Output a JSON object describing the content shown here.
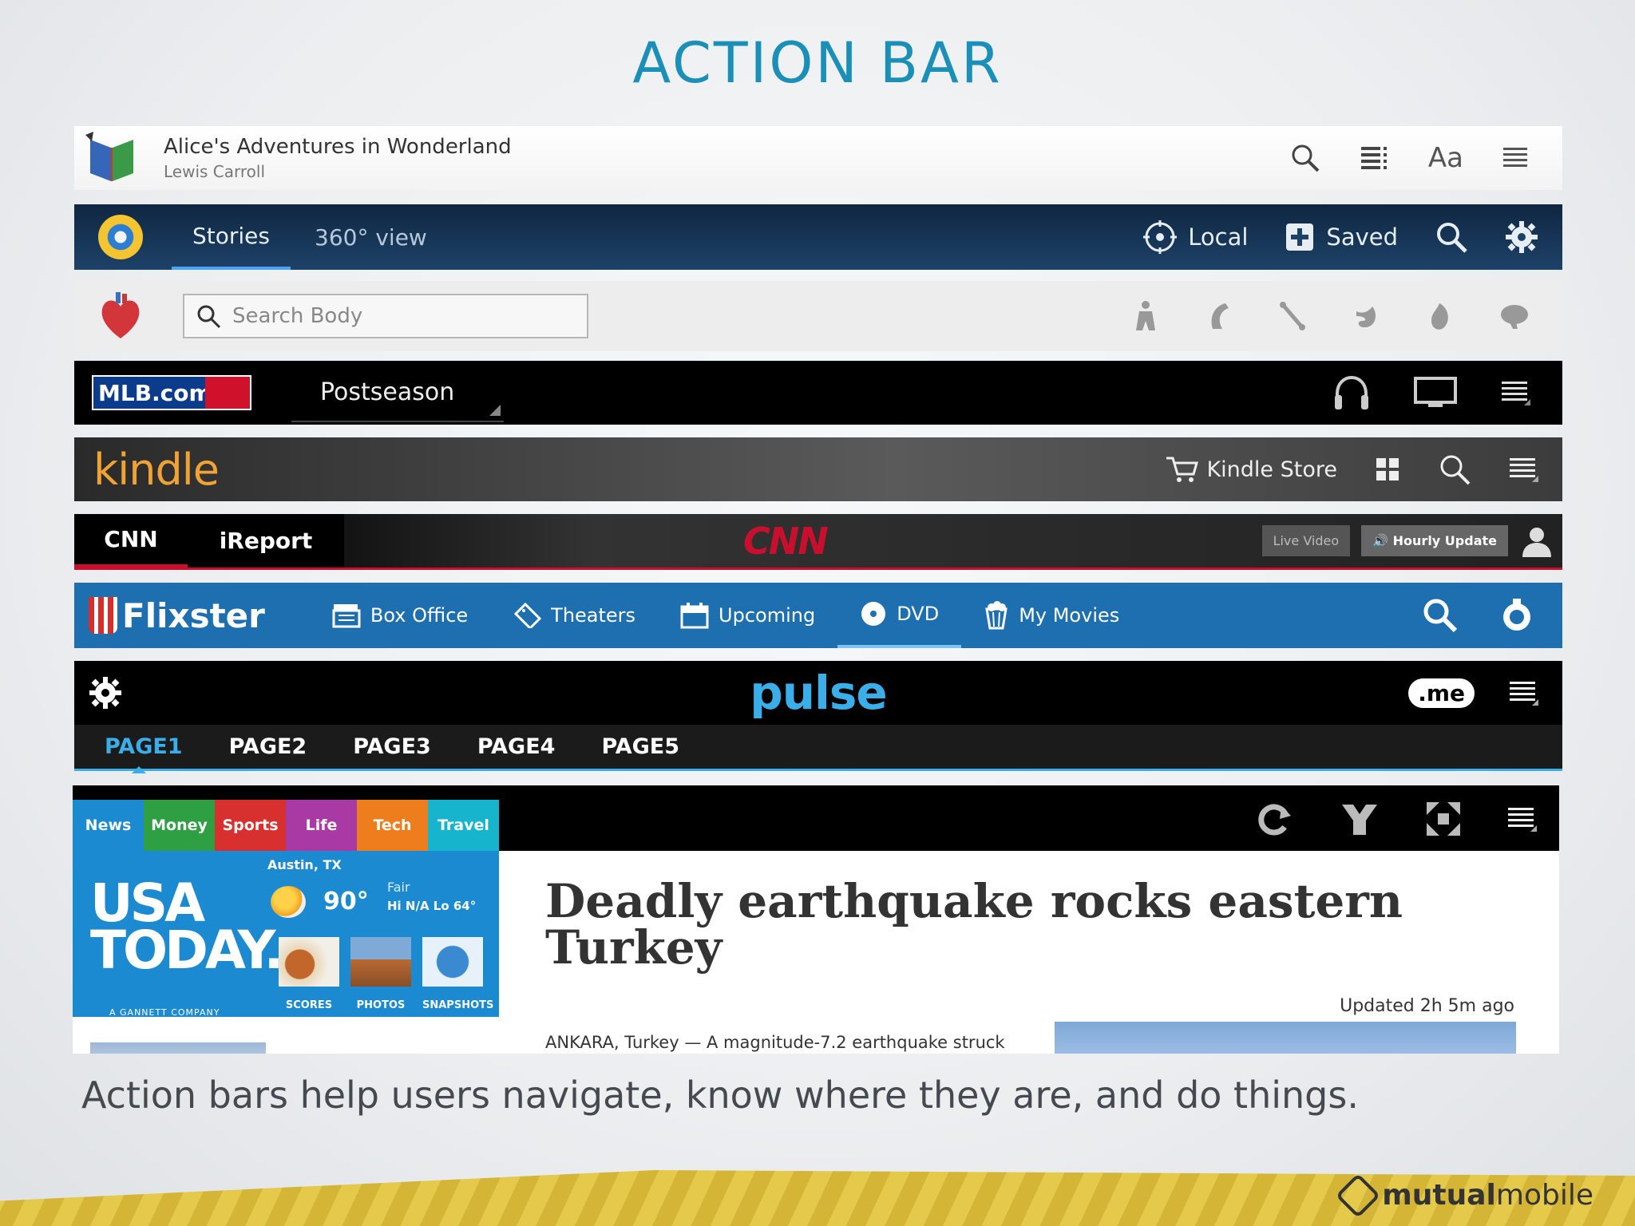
{
  "slide": {
    "title": "ACTION BAR",
    "caption": "Action bars help users navigate, know where they are, and do things.",
    "brand": {
      "strong": "mutual",
      "light": "mobile"
    }
  },
  "books_bar": {
    "title": "Alice's Adventures in Wonderland",
    "author": "Lewis Carroll",
    "font_label": "Aa"
  },
  "news_bar": {
    "tabs": [
      {
        "label": "Stories",
        "active": true
      },
      {
        "label": "360° view",
        "active": false
      }
    ],
    "local_label": "Local",
    "saved_label": "Saved"
  },
  "anatomy_bar": {
    "search_placeholder": "Search Body"
  },
  "mlb_bar": {
    "logo_text": "MLB.com",
    "spinner_label": "Postseason"
  },
  "kindle_bar": {
    "logo_text": "kindle",
    "store_label": "Kindle Store"
  },
  "cnn_bar": {
    "tabs": [
      {
        "label": "CNN",
        "active": true
      },
      {
        "label": "iReport",
        "active": false
      }
    ],
    "logo_text": "CNN",
    "live_video": "Live Video",
    "hourly_update": "Hourly Update"
  },
  "flixster_bar": {
    "logo_text": "Flixster",
    "tabs": [
      {
        "label": "Box Office",
        "icon": "clapperboard-icon",
        "active": false
      },
      {
        "label": "Theaters",
        "icon": "ticket-icon",
        "active": false
      },
      {
        "label": "Upcoming",
        "icon": "calendar-icon",
        "active": false
      },
      {
        "label": "DVD",
        "icon": "disc-icon",
        "active": true
      },
      {
        "label": "My Movies",
        "icon": "popcorn-icon",
        "active": false
      }
    ]
  },
  "pulse_bar": {
    "logo_text": "pulse",
    "me_label": ".me",
    "pages": [
      "PAGE1",
      "PAGE2",
      "PAGE3",
      "PAGE4",
      "PAGE5"
    ],
    "active_page": "PAGE1"
  },
  "usa_today": {
    "categories": [
      {
        "label": "News",
        "color": "#1b8ad1"
      },
      {
        "label": "Money",
        "color": "#2ea043"
      },
      {
        "label": "Sports",
        "color": "#d8302f"
      },
      {
        "label": "Life",
        "color": "#a93aa3"
      },
      {
        "label": "Tech",
        "color": "#ee7d1e"
      },
      {
        "label": "Travel",
        "color": "#17b4cd"
      }
    ],
    "logo_line1": "USA",
    "logo_line2": "TODAY.",
    "gannett": "A GANNETT COMPANY",
    "weather": {
      "city": "Austin, TX",
      "temp": "90°",
      "condition": "Fair",
      "hilo": "Hi N/A  Lo 64°"
    },
    "thumbs": [
      "SCORES",
      "PHOTOS",
      "SNAPSHOTS"
    ],
    "headline": "Deadly earthquake rocks eastern Turkey",
    "updated": "Updated 2h 5m ago",
    "dateline": "ANKARA, Turkey — A magnitude-7.2 earthquake struck"
  },
  "colors": {
    "title_blue": "#1a8fb8",
    "news_bar_bg": "#0f2741",
    "flixster_blue": "#1d6fb0",
    "pulse_blue": "#3aaee8",
    "kindle_orange": "#f0a235",
    "cnn_red": "#c8102e"
  }
}
